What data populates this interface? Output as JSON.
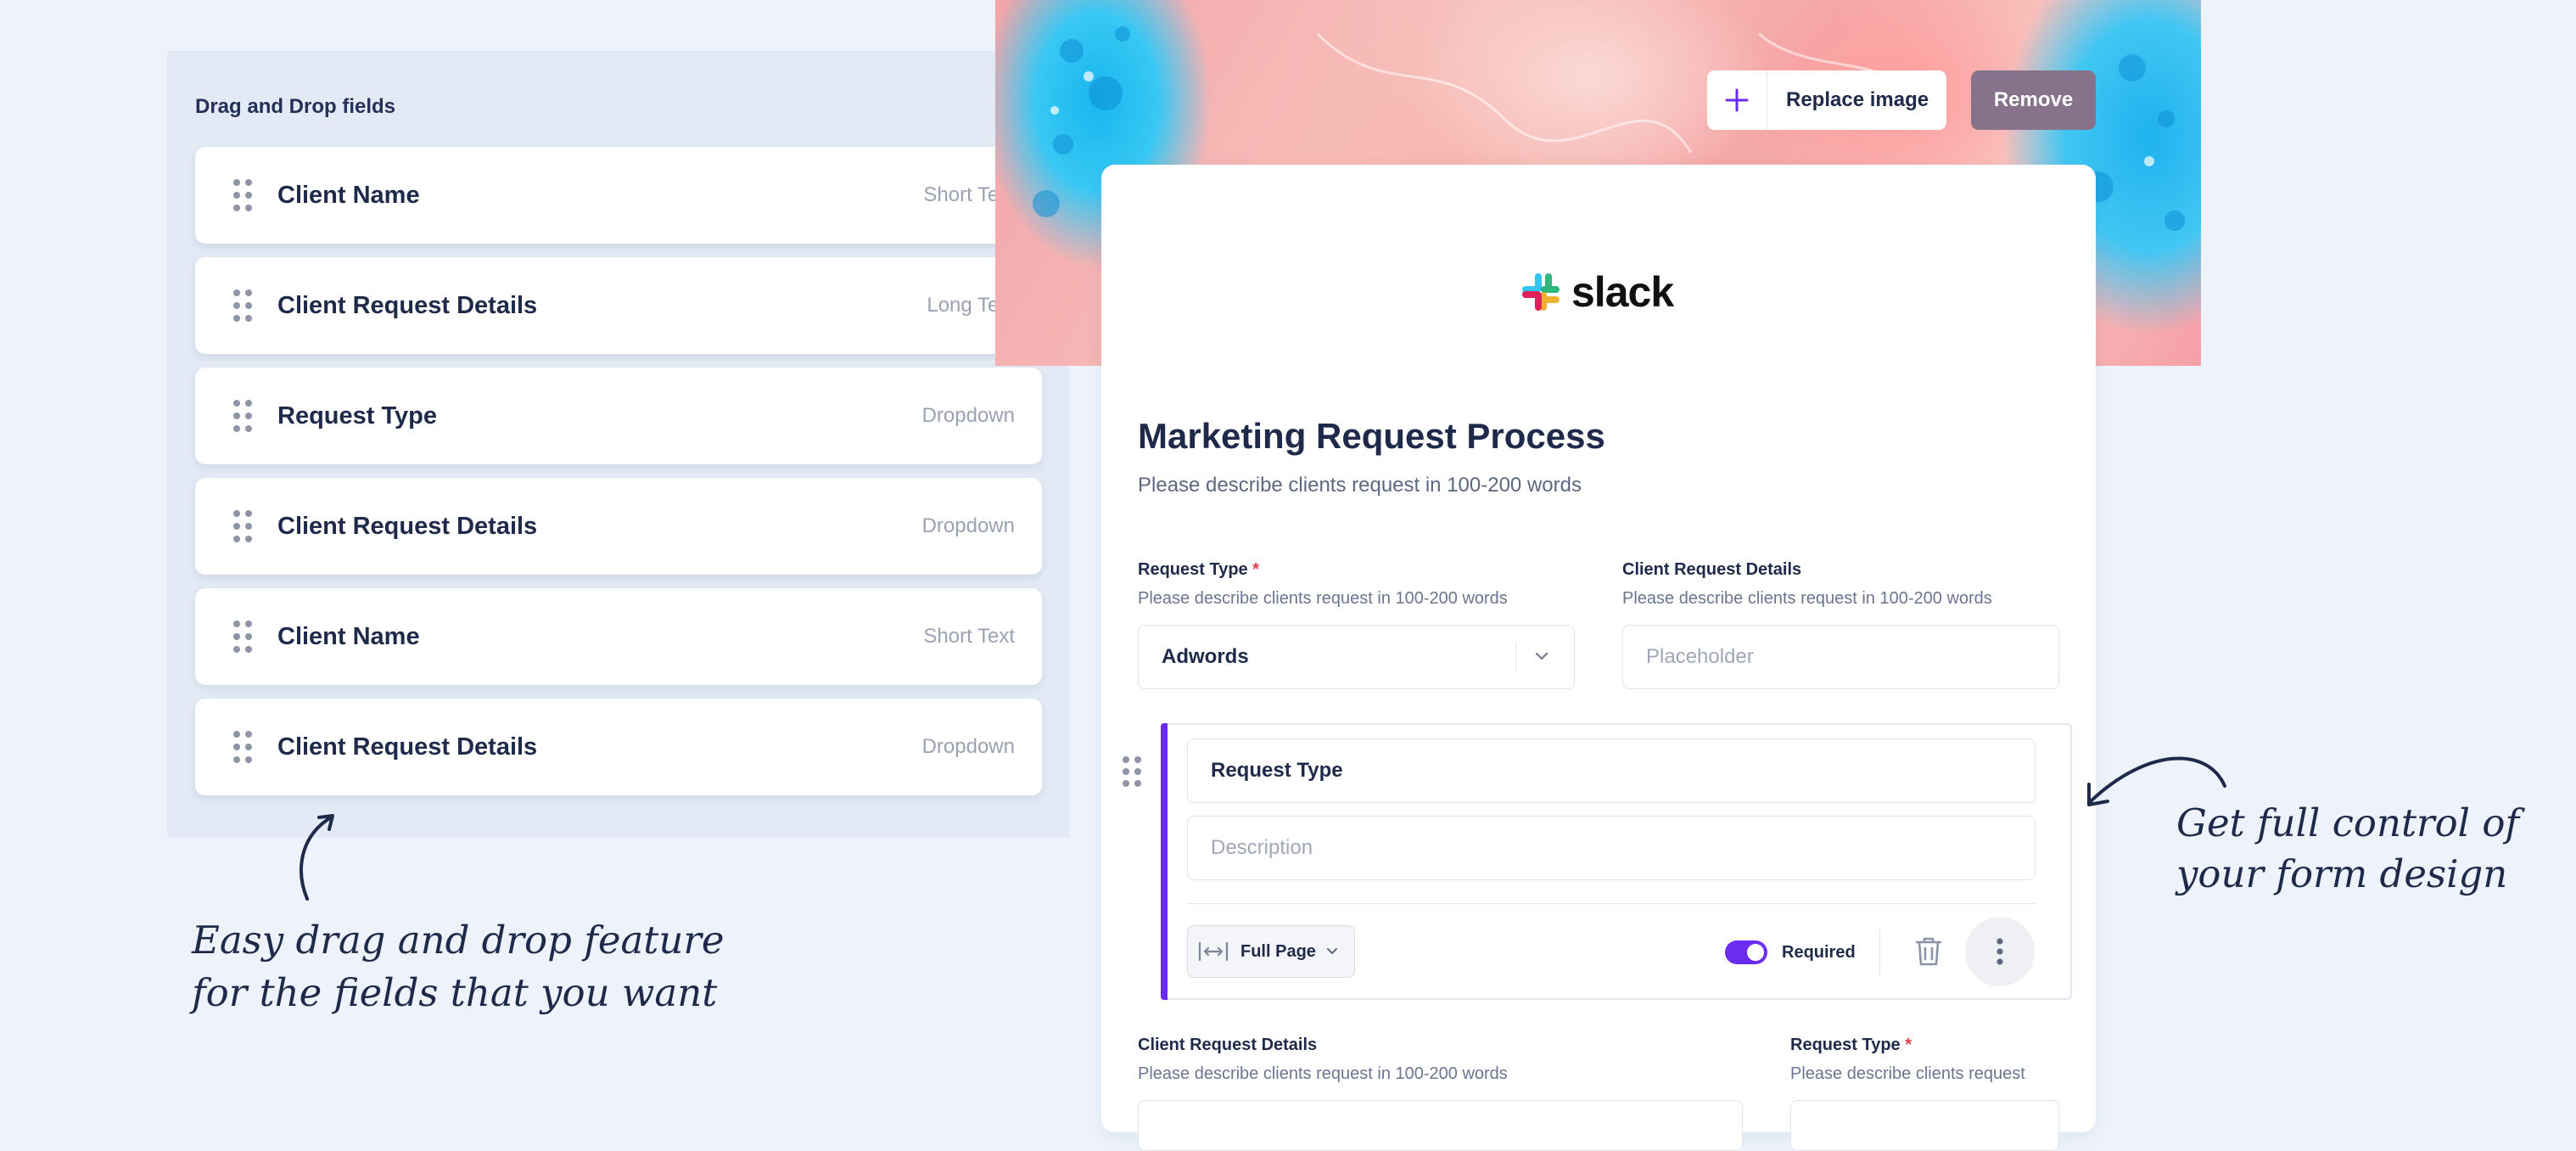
{
  "dnd_panel": {
    "title": "Drag and Drop fields",
    "fields": [
      {
        "name": "Client Name",
        "type": "Short Text"
      },
      {
        "name": "Client Request Details",
        "type": "Long Text"
      },
      {
        "name": "Request Type",
        "type": "Dropdown"
      },
      {
        "name": "Client Request Details",
        "type": "Dropdown"
      },
      {
        "name": "Client Name",
        "type": "Short Text"
      },
      {
        "name": "Client Request Details",
        "type": "Dropdown"
      }
    ]
  },
  "cover": {
    "replace_label": "Replace image",
    "remove_label": "Remove"
  },
  "form": {
    "logo_text": "slack",
    "title": "Marketing Request Process",
    "subtitle": "Please describe clients request in 100-200 words",
    "q1": {
      "label": "Request Type",
      "required_mark": "*",
      "help": "Please describe clients request in 100-200 words",
      "value": "Adwords"
    },
    "q2": {
      "label": "Client Request Details",
      "help": "Please describe clients request in 100-200 words",
      "placeholder": "Placeholder"
    },
    "editor": {
      "title_value": "Request Type",
      "description_placeholder": "Description",
      "width_option": "Full Page",
      "required_label": "Required",
      "required_on": true
    },
    "q3": {
      "label": "Client Request Details",
      "help": "Please describe clients request in 100-200 words"
    },
    "q4": {
      "label": "Request Type",
      "required_mark": "*",
      "help": "Please describe clients request"
    }
  },
  "annotations": {
    "left_line1": "Easy drag and drop feature",
    "left_line2": "for the fields that you want",
    "right_line1": "Get full control of",
    "right_line2": "your form design"
  },
  "colors": {
    "accent": "#6b2cf0",
    "remove_button": "#86738b",
    "required_star": "#e23b4a"
  }
}
